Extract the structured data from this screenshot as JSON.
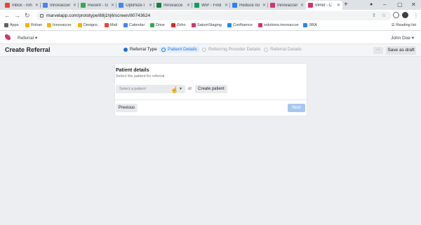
{
  "browser": {
    "tabs": [
      {
        "title": "Inbox - roh",
        "color": "#ea4335"
      },
      {
        "title": "Innovaccer",
        "color": "#4285f4"
      },
      {
        "title": "Recent - G",
        "color": "#34a853"
      },
      {
        "title": "Optimize I",
        "color": "#4285f4"
      },
      {
        "title": "Innovacce",
        "color": "#188038"
      },
      {
        "title": "WIP - Find",
        "color": "#0f9d58"
      },
      {
        "title": "Reduce no",
        "color": "#2684ff"
      },
      {
        "title": "Innovaccer",
        "color": "#d6336c"
      },
      {
        "title": "InRef - C",
        "color": "#d6336c"
      }
    ],
    "url": "marvelapp.com/prototype/88j1hj6/screen/80743624",
    "bookmarks": [
      {
        "label": "Apps",
        "color": "#5f6368"
      },
      {
        "label": "Rohan",
        "color": "#f4b400"
      },
      {
        "label": "Innovaccer",
        "color": "#f4b400"
      },
      {
        "label": "Designs",
        "color": "#f4b400"
      },
      {
        "label": "Mail",
        "color": "#ea4335"
      },
      {
        "label": "Calendar",
        "color": "#4285f4"
      },
      {
        "label": "Drive",
        "color": "#34a853"
      },
      {
        "label": "Zoho",
        "color": "#e42527"
      },
      {
        "label": "SaturnStaging",
        "color": "#d6336c"
      },
      {
        "label": "Confluence",
        "color": "#2684ff"
      },
      {
        "label": "solutions.innovaccer",
        "color": "#d6336c"
      },
      {
        "label": "JIRA",
        "color": "#2684ff"
      }
    ],
    "reading_list": "Reading list"
  },
  "app": {
    "menu_label": "Referral",
    "user_name": "John Doe",
    "page_title": "Create Referral",
    "steps": [
      {
        "label": "Referral Type",
        "state": "done"
      },
      {
        "label": "Patient Details",
        "state": "current"
      },
      {
        "label": "Referring Provider Details",
        "state": "pending"
      },
      {
        "label": "Referral Details",
        "state": "pending"
      }
    ],
    "more_label": "···",
    "save_draft_label": "Save as draft"
  },
  "card": {
    "title": "Patient details",
    "subtitle": "Select the patient for referral",
    "select_placeholder": "Select a patient",
    "or_label": "or",
    "create_label": "Create patient",
    "previous_label": "Previous",
    "next_label": "Next"
  },
  "colors": {
    "accent": "#1a73e8",
    "brand": "#d6336c"
  }
}
